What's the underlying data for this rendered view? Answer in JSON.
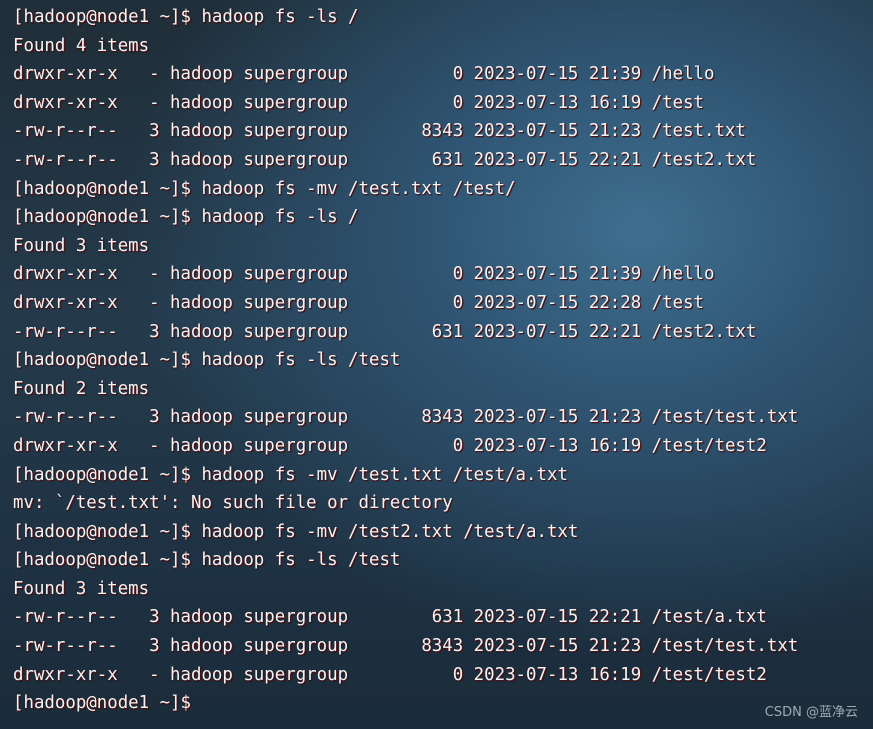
{
  "terminal": {
    "lines": [
      "[hadoop@node1 ~]$ hadoop fs -ls /",
      "Found 4 items",
      "drwxr-xr-x   - hadoop supergroup          0 2023-07-15 21:39 /hello",
      "drwxr-xr-x   - hadoop supergroup          0 2023-07-13 16:19 /test",
      "-rw-r--r--   3 hadoop supergroup       8343 2023-07-15 21:23 /test.txt",
      "-rw-r--r--   3 hadoop supergroup        631 2023-07-15 22:21 /test2.txt",
      "[hadoop@node1 ~]$ hadoop fs -mv /test.txt /test/",
      "[hadoop@node1 ~]$ hadoop fs -ls /",
      "Found 3 items",
      "drwxr-xr-x   - hadoop supergroup          0 2023-07-15 21:39 /hello",
      "drwxr-xr-x   - hadoop supergroup          0 2023-07-15 22:28 /test",
      "-rw-r--r--   3 hadoop supergroup        631 2023-07-15 22:21 /test2.txt",
      "[hadoop@node1 ~]$ hadoop fs -ls /test",
      "Found 2 items",
      "-rw-r--r--   3 hadoop supergroup       8343 2023-07-15 21:23 /test/test.txt",
      "drwxr-xr-x   - hadoop supergroup          0 2023-07-13 16:19 /test/test2",
      "[hadoop@node1 ~]$ hadoop fs -mv /test.txt /test/a.txt",
      "mv: `/test.txt': No such file or directory",
      "[hadoop@node1 ~]$ hadoop fs -mv /test2.txt /test/a.txt",
      "[hadoop@node1 ~]$ hadoop fs -ls /test",
      "Found 3 items",
      "-rw-r--r--   3 hadoop supergroup        631 2023-07-15 22:21 /test/a.txt",
      "-rw-r--r--   3 hadoop supergroup       8343 2023-07-15 21:23 /test/test.txt",
      "drwxr-xr-x   - hadoop supergroup          0 2023-07-13 16:19 /test/test2",
      "[hadoop@node1 ~]$"
    ]
  },
  "watermark": "CSDN @蓝净云"
}
